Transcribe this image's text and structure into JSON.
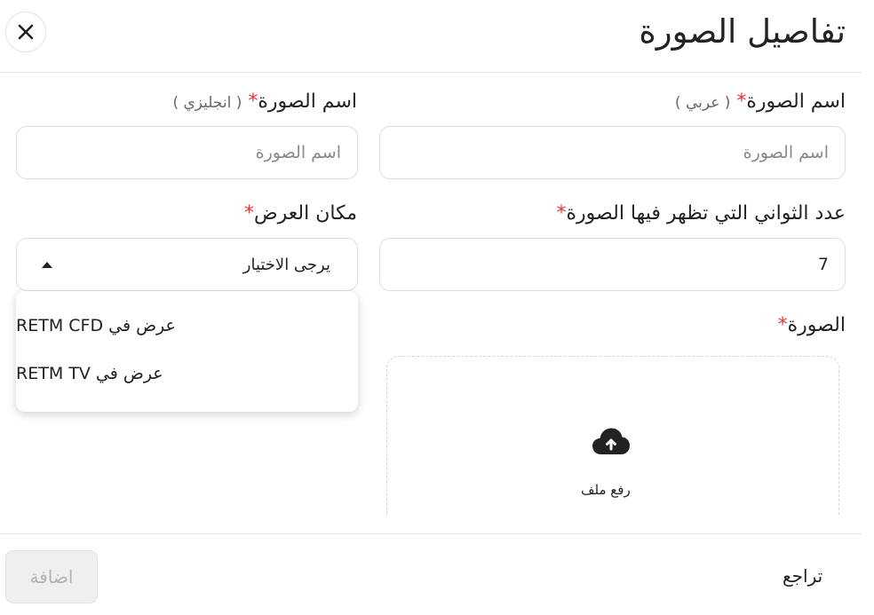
{
  "dialog": {
    "title": "تفاصيل الصورة"
  },
  "fields": {
    "name_ar": {
      "label": "اسم الصورة",
      "required": "*",
      "lang": "( عربي )",
      "placeholder": "اسم الصورة",
      "value": ""
    },
    "name_en": {
      "label": "اسم الصورة",
      "required": "*",
      "lang": "( انجليزي )",
      "placeholder": "اسم الصورة",
      "value": ""
    },
    "seconds": {
      "label": "عدد الثواني التي تظهر فيها الصورة",
      "required": "*",
      "value": "7"
    },
    "display_place": {
      "label": "مكان العرض",
      "required": "*",
      "selected": "يرجى الاختيار",
      "options": [
        "عرض في RETM CFD",
        "عرض في RETM TV"
      ]
    },
    "image": {
      "label": "الصورة",
      "required": "*",
      "upload_text": "رفع ملف"
    }
  },
  "footer": {
    "add_label": "اضافة",
    "back_label": "تراجع"
  },
  "icons": {
    "close": "close-icon",
    "caret": "caret-up-icon",
    "upload": "cloud-upload-icon"
  },
  "colors": {
    "required_star": "#e53935",
    "disabled_button_bg": "#efefef",
    "disabled_button_text": "#b3b3b3"
  }
}
